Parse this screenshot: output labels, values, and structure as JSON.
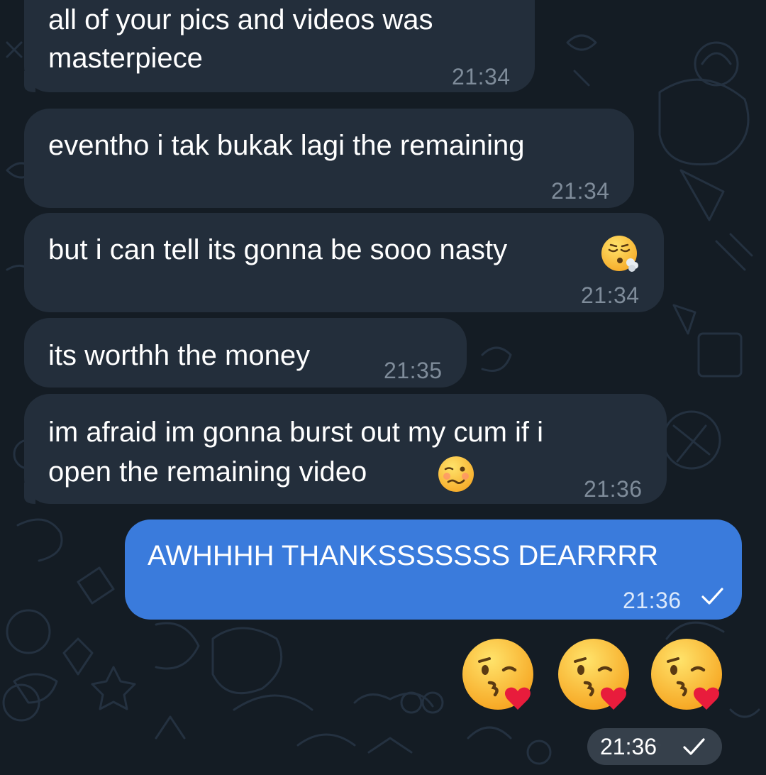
{
  "messages": [
    {
      "lines": [
        "all of your pics and videos was",
        "masterpiece"
      ],
      "time": "21:34"
    },
    {
      "lines": [
        "eventho i tak bukak lagi the remaining"
      ],
      "time": "21:34"
    },
    {
      "lines": [
        "but i can tell its gonna be sooo nasty"
      ],
      "emoji": "exhaling-face-emoji",
      "time": "21:34"
    },
    {
      "lines": [
        "its worthh the money"
      ],
      "time": "21:35"
    },
    {
      "lines": [
        "im afraid im gonna burst out my cum if i",
        "open the remaining video"
      ],
      "emoji": "woozy-face-emoji",
      "time": "21:36"
    }
  ],
  "outgoing": {
    "text": "AWHHHH THANKSSSSSSS DEARRRR",
    "time": "21:36",
    "status_icon": "single-check-icon"
  },
  "emoji_message": {
    "emojis": [
      "face-blowing-kiss-emoji",
      "face-blowing-kiss-emoji",
      "face-blowing-kiss-emoji"
    ],
    "time": "21:36",
    "status_icon": "single-check-icon"
  },
  "colors": {
    "background": "#141c24",
    "incoming_bubble": "#232e3b",
    "outgoing_bubble": "#3a7bdc",
    "incoming_time": "#7f8c9a"
  }
}
